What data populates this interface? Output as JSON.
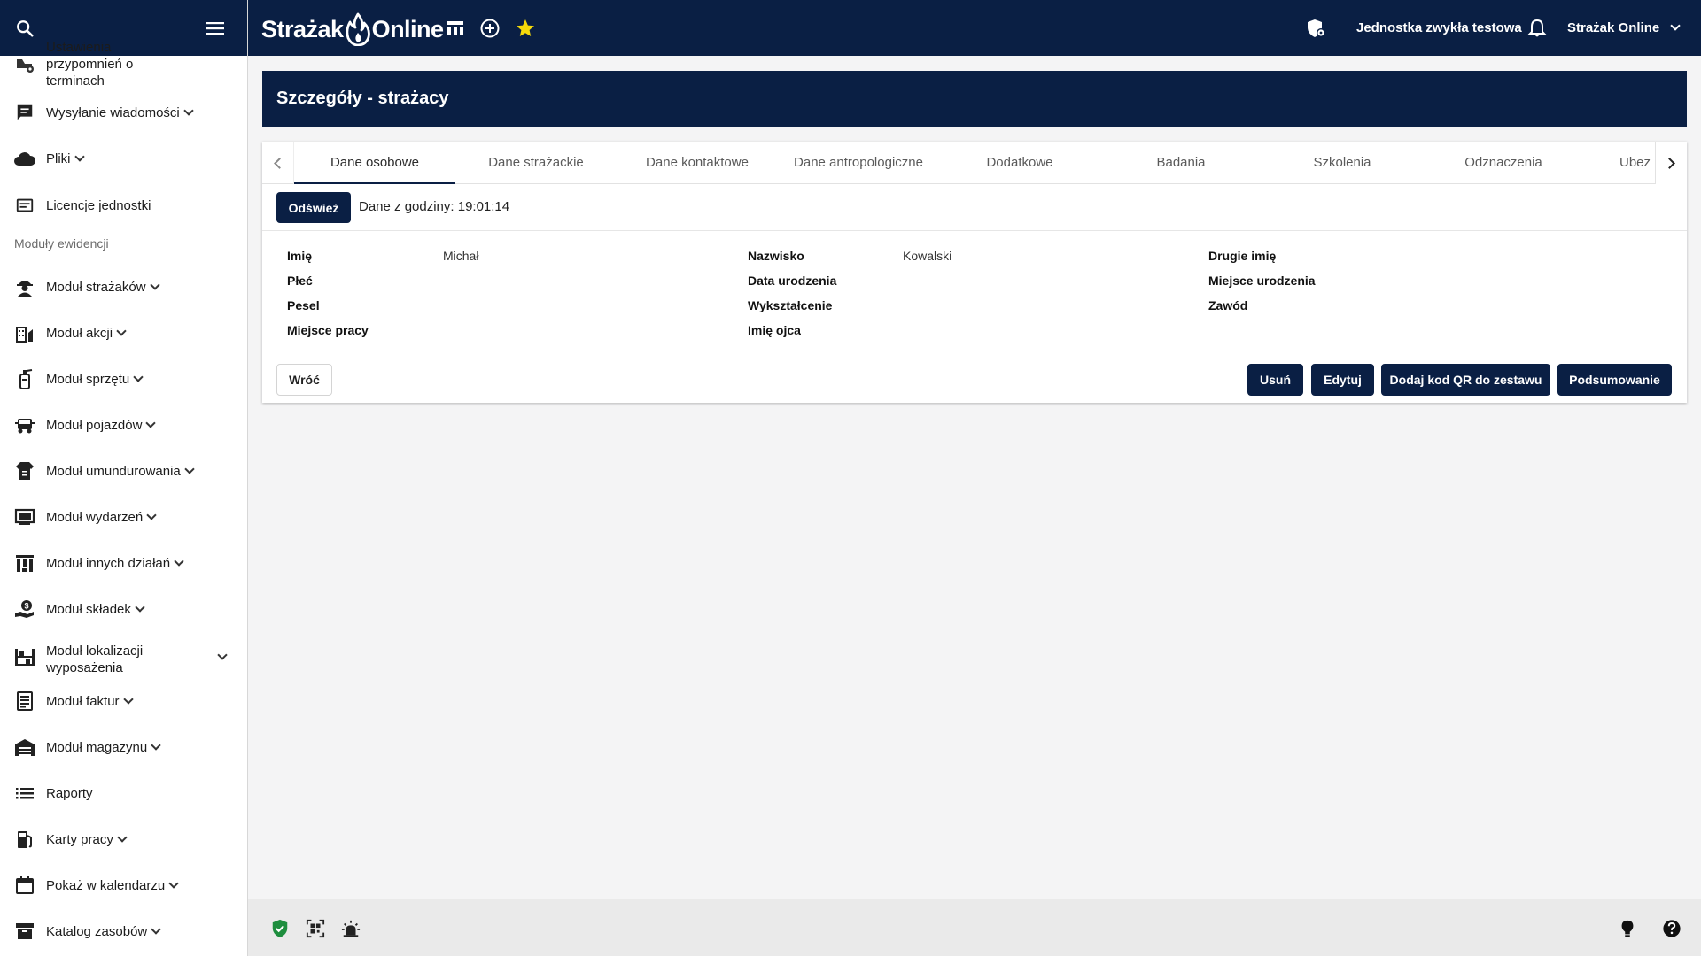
{
  "header": {
    "brand_left": "Strażak",
    "brand_right": "Online",
    "unit_name": "Jednostka zwykła testowa",
    "user_menu": "Strażak Online"
  },
  "sidebar": {
    "items": [
      {
        "label": "Ustawienia przypomnień o terminach"
      },
      {
        "label": "Wysyłanie wiadomości"
      },
      {
        "label": "Pliki"
      },
      {
        "label": "Licencje jednostki"
      }
    ],
    "section_label": "Moduły ewidencji",
    "modules": [
      {
        "label": "Moduł strażaków"
      },
      {
        "label": "Moduł akcji"
      },
      {
        "label": "Moduł sprzętu"
      },
      {
        "label": "Moduł pojazdów"
      },
      {
        "label": "Moduł umundurowania"
      },
      {
        "label": "Moduł wydarzeń"
      },
      {
        "label": "Moduł innych działań"
      },
      {
        "label": "Moduł składek"
      },
      {
        "label": "Moduł lokalizacji wyposażenia"
      },
      {
        "label": "Moduł faktur"
      },
      {
        "label": "Moduł magazynu"
      },
      {
        "label": "Raporty"
      },
      {
        "label": "Karty pracy"
      },
      {
        "label": "Pokaż w kalendarzu"
      },
      {
        "label": "Katalog zasobów"
      }
    ]
  },
  "page": {
    "title": "Szczegóły - strażacy"
  },
  "tabs": [
    "Dane osobowe",
    "Dane strażackie",
    "Dane kontaktowe",
    "Dane antropologiczne",
    "Dodatkowe",
    "Badania",
    "Szkolenia",
    "Odznaczenia",
    "Ubez"
  ],
  "refresh": {
    "button": "Odśwież",
    "timestamp_text": "Dane z godziny: 19:01:14"
  },
  "fields": {
    "imie": {
      "label": "Imię",
      "value": "Michał"
    },
    "nazwisko": {
      "label": "Nazwisko",
      "value": "Kowalski"
    },
    "drugie_imie": {
      "label": "Drugie imię",
      "value": ""
    },
    "plec": {
      "label": "Płeć",
      "value": ""
    },
    "data_urodzenia": {
      "label": "Data urodzenia",
      "value": ""
    },
    "miejsce_urodzenia": {
      "label": "Miejsce urodzenia",
      "value": ""
    },
    "pesel": {
      "label": "Pesel",
      "value": ""
    },
    "wyksztalcenie": {
      "label": "Wykształcenie",
      "value": ""
    },
    "zawod": {
      "label": "Zawód",
      "value": ""
    },
    "miejsce_pracy": {
      "label": "Miejsce pracy",
      "value": ""
    },
    "imie_ojca": {
      "label": "Imię ojca",
      "value": ""
    }
  },
  "actions": {
    "back": "Wróć",
    "delete": "Usuń",
    "edit": "Edytuj",
    "add_qr": "Dodaj kod QR do zestawu",
    "summary": "Podsumowanie"
  },
  "colors": {
    "navy": "#0a1f44",
    "star": "#f5d90a",
    "shield_green": "#1e8e3e"
  }
}
